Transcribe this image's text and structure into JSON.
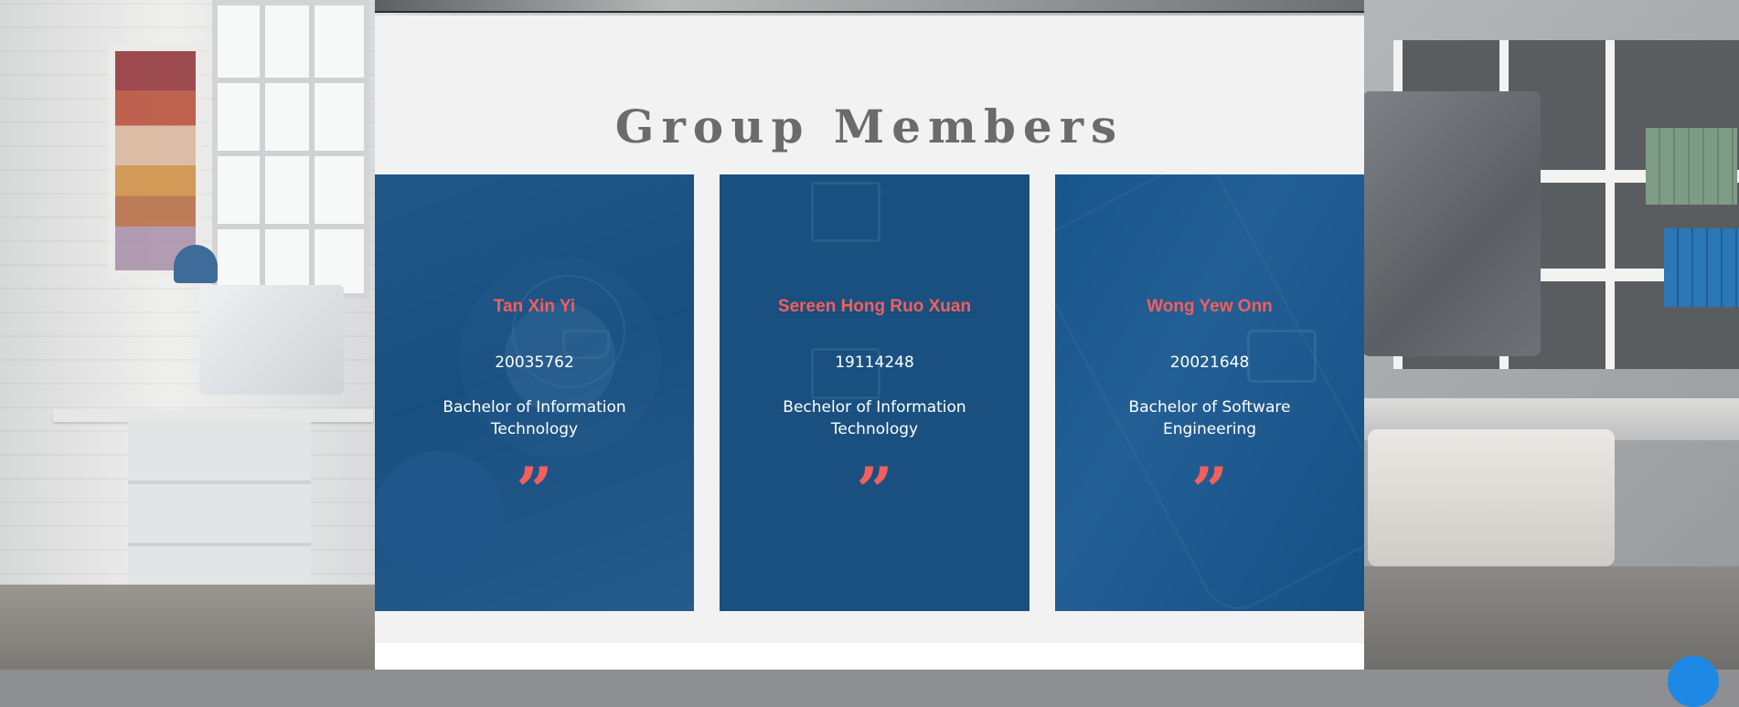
{
  "section": {
    "title": "Group Members"
  },
  "members": [
    {
      "name": "Tan Xin Yi",
      "student_id": "20035762",
      "degree": "Bachelor of Information Technology",
      "quote_mark": "”"
    },
    {
      "name": "Sereen Hong Ruo Xuan",
      "student_id": "19114248",
      "degree": "Bechelor of Information Technology",
      "quote_mark": "”"
    },
    {
      "name": "Wong Yew Onn",
      "student_id": "20021648",
      "degree": "Bachelor of Software Engineering",
      "quote_mark": "”"
    }
  ],
  "colors": {
    "accent": "#f25f5c",
    "card_tint": "#14548c",
    "title": "#6b6b6b",
    "panel": "#f2f2f2"
  },
  "icons": {
    "quote": "quote-icon",
    "chat": "chat-icon"
  }
}
